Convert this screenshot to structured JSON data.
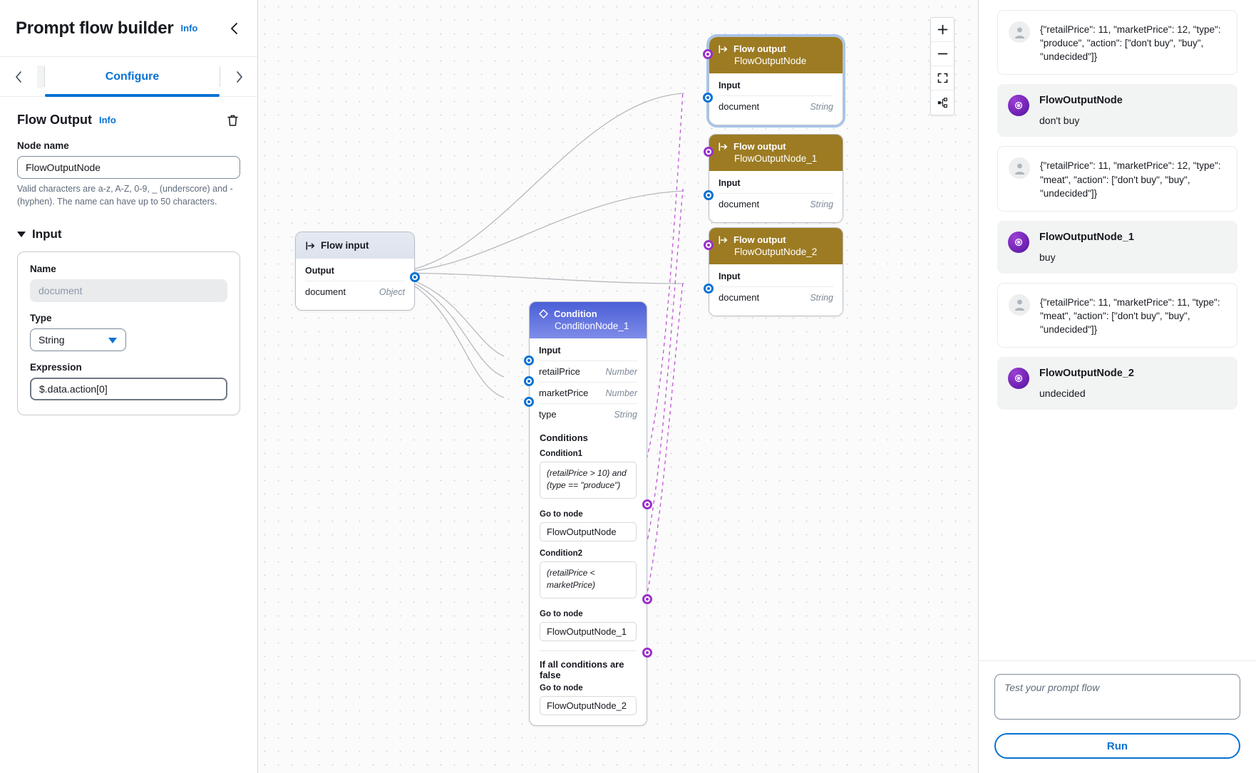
{
  "header": {
    "title": "Prompt flow builder",
    "info_label": "Info",
    "collapse_icon": "chevron-left-icon"
  },
  "tabs": {
    "prev_icon": "chevron-left-icon",
    "next_icon": "chevron-right-icon",
    "active_label": "Configure"
  },
  "config": {
    "section_title": "Flow Output",
    "section_info": "Info",
    "delete_icon": "trash-icon",
    "node_name_label": "Node name",
    "node_name_value": "FlowOutputNode",
    "node_name_hint": "Valid characters are a-z, A-Z, 0-9, _ (underscore) and -(hyphen). The name can have up to 50 characters.",
    "input_group_label": "Input",
    "name_label": "Name",
    "name_value": "document",
    "type_label": "Type",
    "type_value": "String",
    "expression_label": "Expression",
    "expression_value": "$.data.action[0]"
  },
  "canvas": {
    "tools": [
      {
        "name": "zoom-in-icon",
        "glyph": "+"
      },
      {
        "name": "zoom-out-icon",
        "glyph": "–"
      },
      {
        "name": "fit-screen-icon",
        "glyph": "fit"
      },
      {
        "name": "auto-layout-icon",
        "glyph": "layout"
      }
    ],
    "flow_input": {
      "kind": "Flow input",
      "output_label": "Output",
      "port_name": "document",
      "port_type": "Object"
    },
    "flow_outputs": [
      {
        "kind": "Flow output",
        "name": "FlowOutputNode",
        "input_label": "Input",
        "port_name": "document",
        "port_type": "String",
        "selected": true
      },
      {
        "kind": "Flow output",
        "name": "FlowOutputNode_1",
        "input_label": "Input",
        "port_name": "document",
        "port_type": "String",
        "selected": false
      },
      {
        "kind": "Flow output",
        "name": "FlowOutputNode_2",
        "input_label": "Input",
        "port_name": "document",
        "port_type": "String",
        "selected": false
      }
    ],
    "condition_node": {
      "kind": "Condition",
      "name": "ConditionNode_1",
      "input_label": "Input",
      "inputs": [
        {
          "name": "retailPrice",
          "type": "Number"
        },
        {
          "name": "marketPrice",
          "type": "Number"
        },
        {
          "name": "type",
          "type": "String"
        }
      ],
      "conditions_label": "Conditions",
      "condition1_label": "Condition1",
      "condition1_value": "(retailPrice > 10) and (type == \"produce\")",
      "goto1_label": "Go to node",
      "goto1_value": "FlowOutputNode",
      "condition2_label": "Condition2",
      "condition2_value": "(retailPrice < marketPrice)",
      "goto2_label": "Go to node",
      "goto2_value": "FlowOutputNode_1",
      "fallback_label": "If all conditions are false",
      "goto3_label": "Go to node",
      "goto3_value": "FlowOutputNode_2"
    }
  },
  "test_panel": {
    "messages": [
      {
        "role": "user",
        "text": "{\"retailPrice\": 11, \"marketPrice\": 12, \"type\": \"produce\", \"action\": [\"don't buy\", \"buy\", \"undecided\"]}"
      },
      {
        "role": "bot",
        "name": "FlowOutputNode",
        "text": "don't buy"
      },
      {
        "role": "user",
        "text": "{\"retailPrice\": 11, \"marketPrice\": 12, \"type\": \"meat\", \"action\": [\"don't buy\", \"buy\", \"undecided\"]}"
      },
      {
        "role": "bot",
        "name": "FlowOutputNode_1",
        "text": "buy"
      },
      {
        "role": "user",
        "text": "{\"retailPrice\": 11, \"marketPrice\": 11, \"type\": \"meat\", \"action\": [\"don't buy\", \"buy\", \"undecided\"]}"
      },
      {
        "role": "bot",
        "name": "FlowOutputNode_2",
        "text": "undecided"
      }
    ],
    "input_placeholder": "Test your prompt flow",
    "input_value": "",
    "run_label": "Run"
  },
  "colors": {
    "accent_blue": "#0972d3",
    "flow_output_gold": "#9c7b22",
    "condition_indigo": "#4b5fd6",
    "port_purple": "#9b30c9"
  }
}
